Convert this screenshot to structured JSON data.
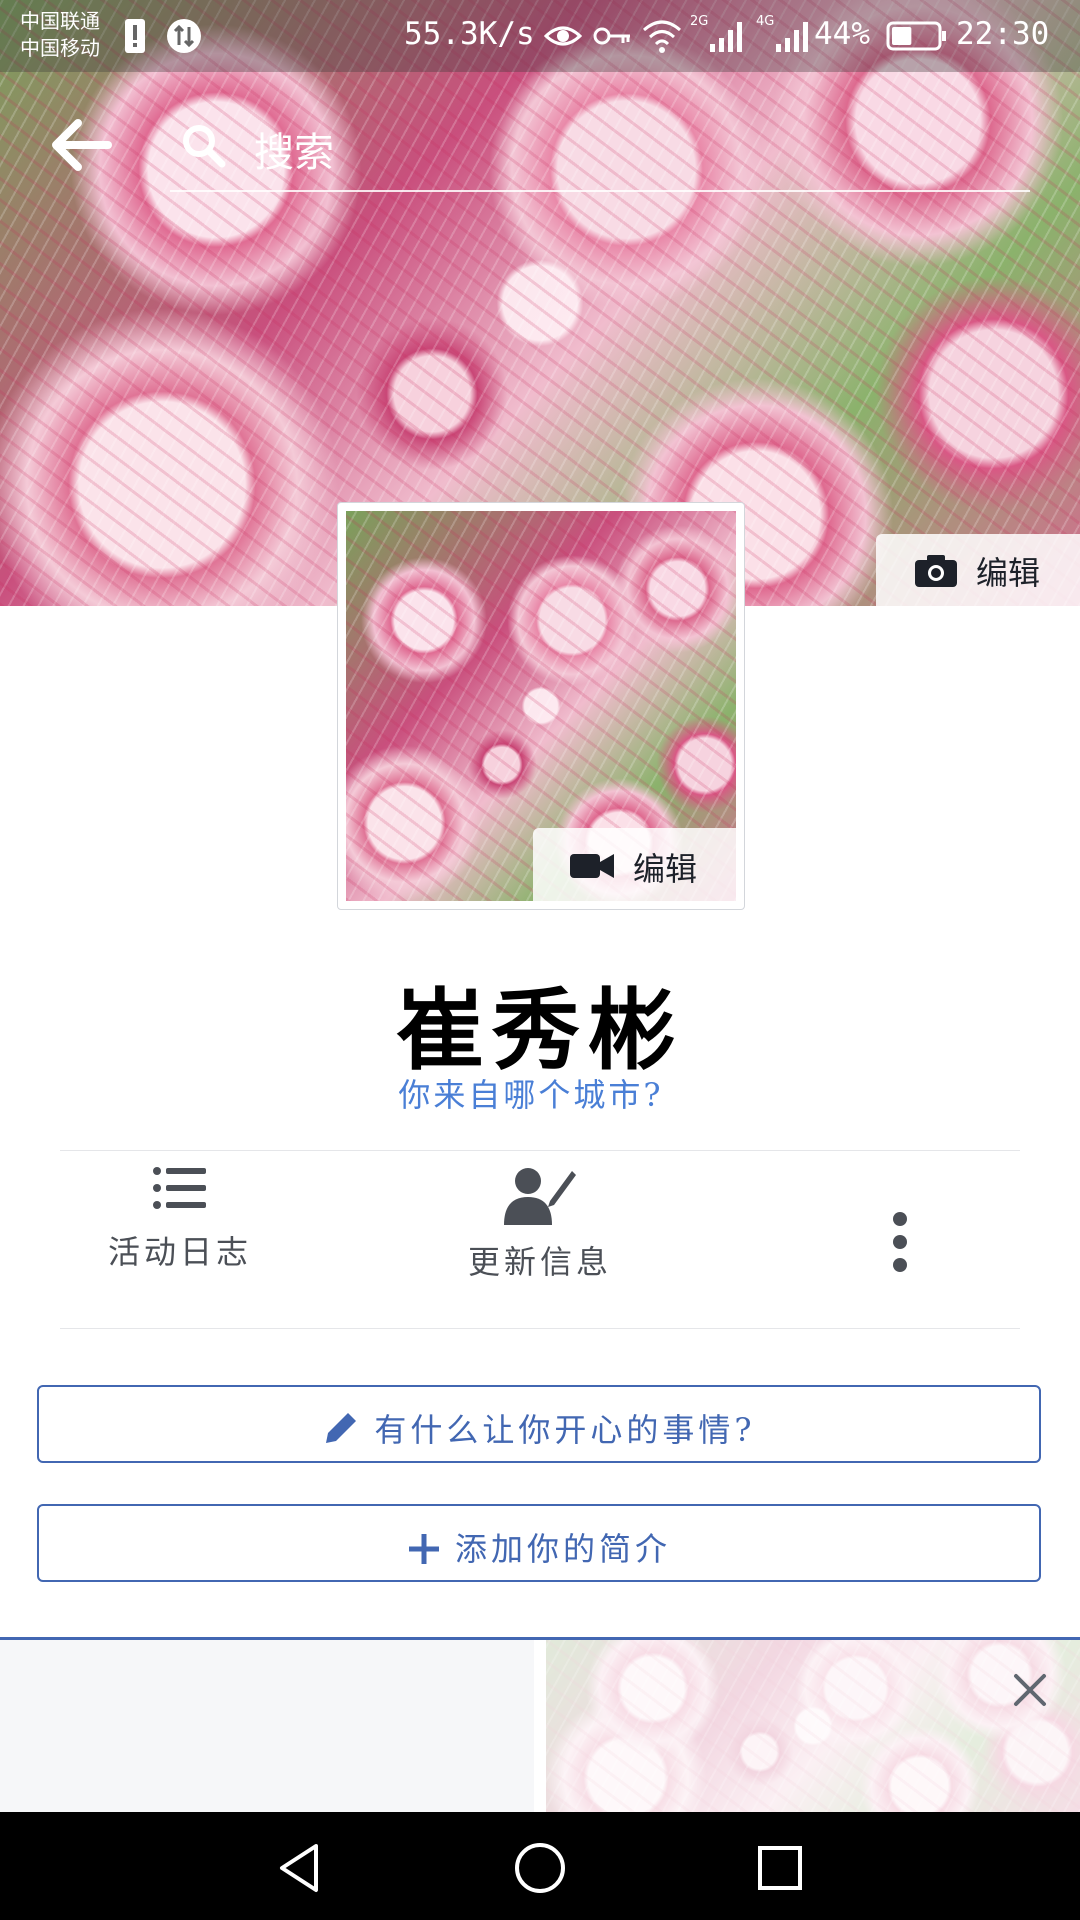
{
  "status_bar": {
    "carrier_1": "中国联通",
    "carrier_2": "中国移动",
    "net_speed": "55.3K/s",
    "network_2g": "2G",
    "network_4g": "4G",
    "battery_pct": "44%",
    "battery_level": 0.44,
    "time": "22:30"
  },
  "header": {
    "search_placeholder": "搜索"
  },
  "cover": {
    "edit_label": "编辑"
  },
  "avatar": {
    "edit_label": "编辑"
  },
  "profile": {
    "name": "崔秀彬",
    "city_prompt": "你来自哪个城市?"
  },
  "actions": {
    "activity_log": "活动日志",
    "update_info": "更新信息"
  },
  "buttons": {
    "status_prompt": "有什么让你开心的事情?",
    "add_bio": "添加你的简介"
  },
  "colors": {
    "accent": "#4267b2",
    "link": "#4a7fd6",
    "icon_gray": "#4b4f56"
  }
}
